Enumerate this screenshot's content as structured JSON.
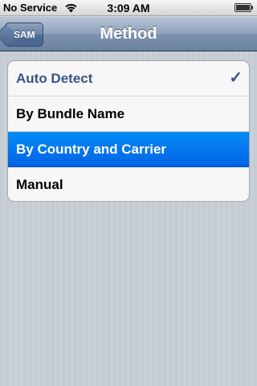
{
  "status_bar": {
    "carrier": "No Service",
    "time": "3:09 AM",
    "wifi_icon": "wifi-icon",
    "battery_icon": "battery-icon"
  },
  "nav": {
    "back_label": "SAM",
    "title": "Method"
  },
  "list": {
    "items": [
      {
        "label": "Auto Detect",
        "checked": true,
        "selected": false
      },
      {
        "label": "By Bundle Name",
        "checked": false,
        "selected": false
      },
      {
        "label": "By Country and Carrier",
        "checked": false,
        "selected": true
      },
      {
        "label": "Manual",
        "checked": false,
        "selected": false
      }
    ],
    "checkmark": "✓"
  },
  "colors": {
    "checked_text": "#385487",
    "selected_row": "#0163e6",
    "nav_bar": "#6b83a2"
  }
}
